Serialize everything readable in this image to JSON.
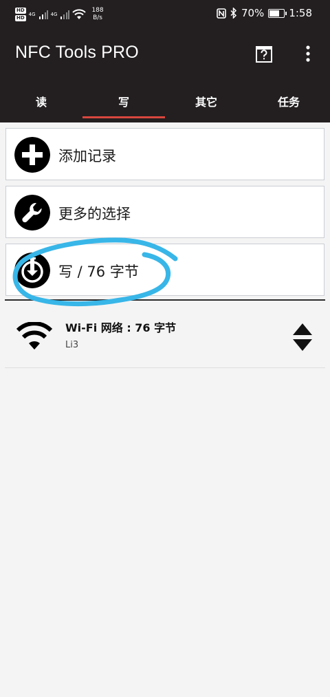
{
  "status_bar": {
    "hd1": "HD",
    "hd2": "HD",
    "signal1": "4G",
    "signal2": "4G",
    "speed_value": "188",
    "speed_unit": "B/s",
    "battery": "70%",
    "battery_level": 0.7,
    "time": "1:58"
  },
  "app_bar": {
    "title": "NFC Tools PRO",
    "icons": [
      "help-icon",
      "more-vert-icon"
    ]
  },
  "tabs": [
    {
      "label": "读",
      "active": false
    },
    {
      "label": "写",
      "active": true
    },
    {
      "label": "其它",
      "active": false
    },
    {
      "label": "任务",
      "active": false
    }
  ],
  "actions": [
    {
      "label": "添加记录",
      "icon": "plus-circle-icon"
    },
    {
      "label": "更多的选择",
      "icon": "wrench-circle-icon"
    },
    {
      "label": "写 / 76 字节",
      "icon": "write-tag-icon"
    }
  ],
  "records": [
    {
      "title": "Wi-Fi 网络 : 76 字节",
      "subtitle": "Li3",
      "icon": "wifi-icon"
    }
  ],
  "colors": {
    "appbar": "#231f20",
    "tab_indicator": "#d9473f",
    "annotation": "#38b6e8",
    "background": "#f4f4f4"
  }
}
